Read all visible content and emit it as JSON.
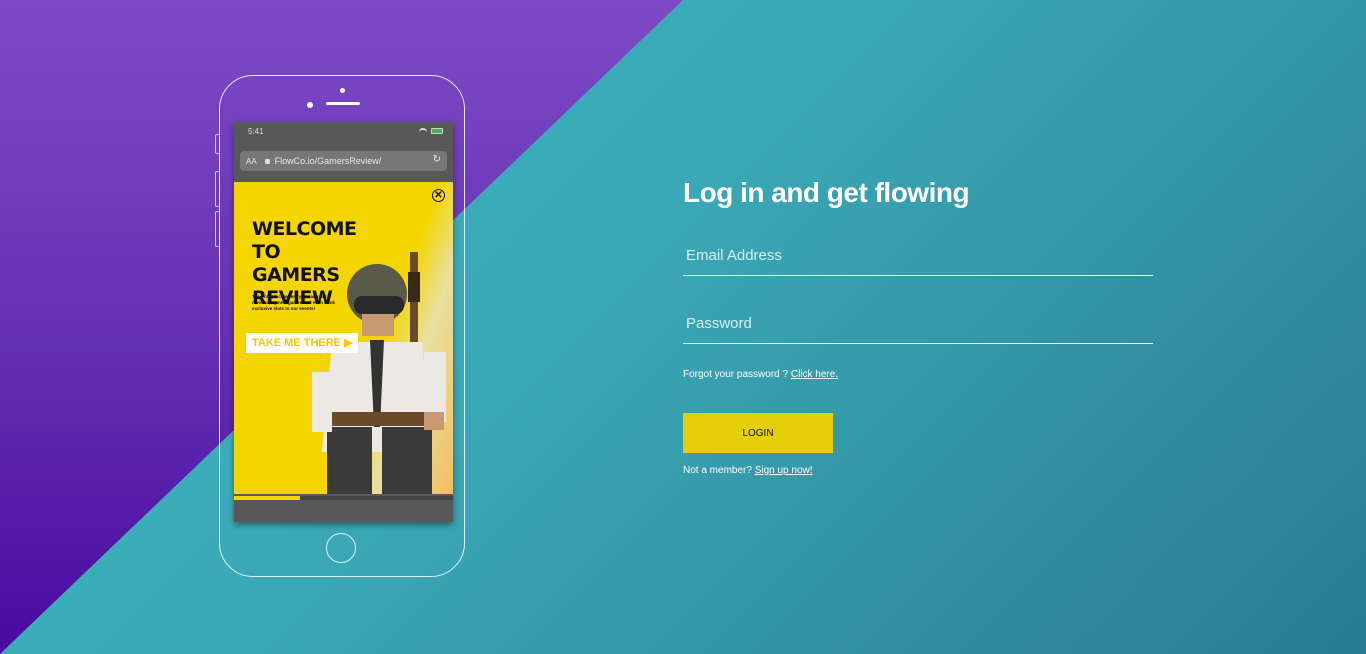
{
  "phone": {
    "status_time": "5:41",
    "url": "FlowCo.io/GamersReview/",
    "url_aa": "AA",
    "ad": {
      "headline_1": "WELCOME",
      "headline_2": "TO GAMERS",
      "headline_3": "REVIEW",
      "blurb": "The only place where you can read reviews, try new games and even book exclusive slots to our events!",
      "cta": "TAKE ME THERE ▶",
      "close_glyph": "✕"
    },
    "progress_fraction": 0.3
  },
  "form": {
    "title": "Log in and get flowing",
    "email_placeholder": "Email Address",
    "password_placeholder": "Password",
    "forgot_text": "Forgot your password ?",
    "forgot_link": "Click here.",
    "login_label": "LOGIN",
    "signup_text": "Not a member?",
    "signup_link": "Sign up now!"
  },
  "colors": {
    "purple": "#7e49c6",
    "teal": "#42b8c4",
    "accent_yellow": "#e6cf0a"
  }
}
